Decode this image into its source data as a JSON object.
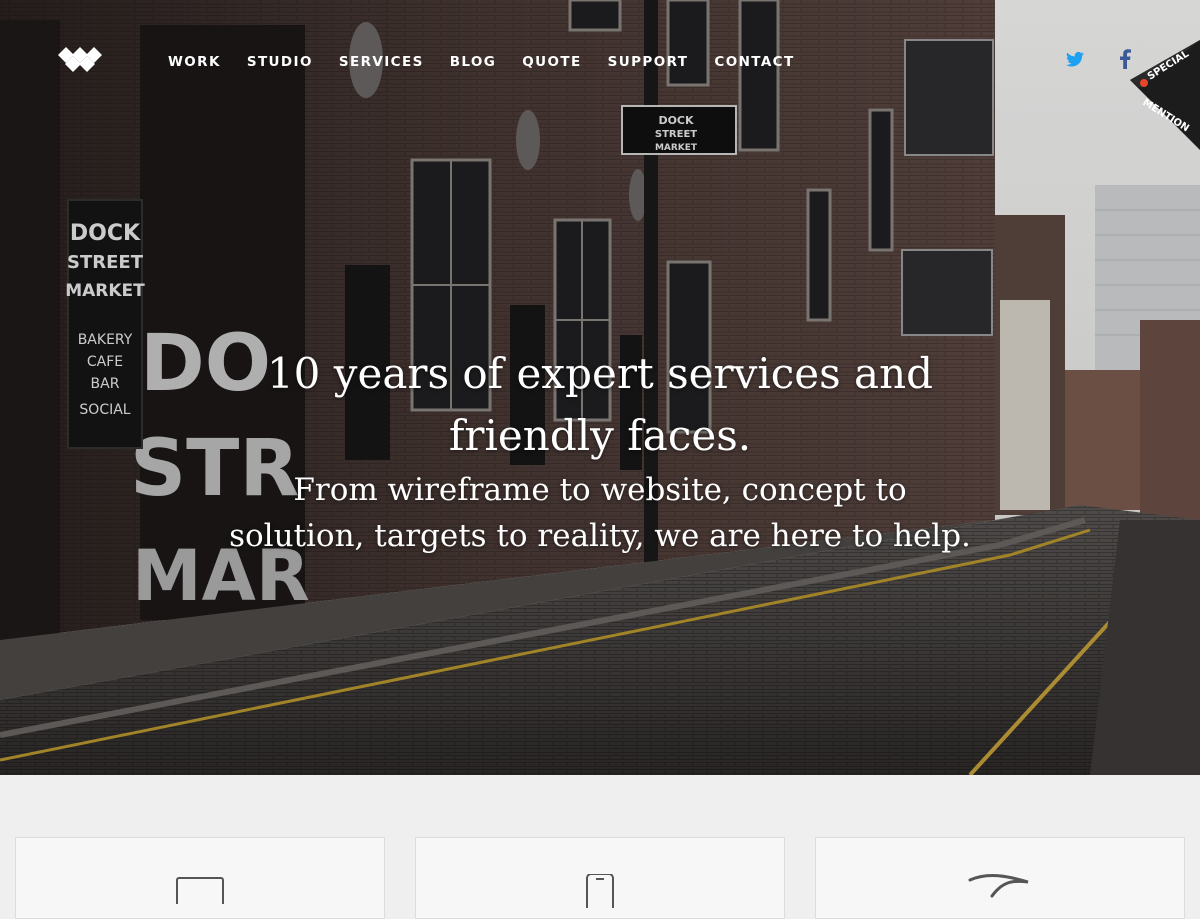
{
  "nav": {
    "items": [
      "WORK",
      "STUDIO",
      "SERVICES",
      "BLOG",
      "QUOTE",
      "SUPPORT",
      "CONTACT"
    ]
  },
  "social": {
    "twitter_icon": "twitter-icon",
    "facebook_icon": "facebook-icon",
    "twitter_color": "#1da1f2",
    "facebook_color": "#3b5998"
  },
  "ribbon": {
    "line1": "SPECIAL",
    "line2": "MENTION"
  },
  "hero": {
    "headline_line1": "10 years of expert services and",
    "headline_line2": "friendly faces.",
    "sub_line1": "From wireframe to website, concept to",
    "sub_line2": "solution, targets to reality, we are here to help."
  },
  "signage": {
    "dock_sign_line1": "DOCK",
    "dock_sign_line2": "STREET",
    "dock_sign_line3": "MARKET",
    "dock_sign_line4": "BAKERY",
    "dock_sign_line5": "CAFE",
    "dock_sign_line6": "BAR",
    "dock_sign_line7": "SOCIAL",
    "hanging_sign_line1": "DOCK",
    "hanging_sign_line2": "STREET",
    "hanging_sign_line3": "MARKET",
    "wall_letters_1": "DO",
    "wall_letters_2": "STR",
    "wall_letters_3": "MAR"
  },
  "features": {
    "cards": [
      {
        "icon": "tablet-icon"
      },
      {
        "icon": "phone-icon"
      },
      {
        "icon": "swoosh-icon"
      }
    ]
  }
}
